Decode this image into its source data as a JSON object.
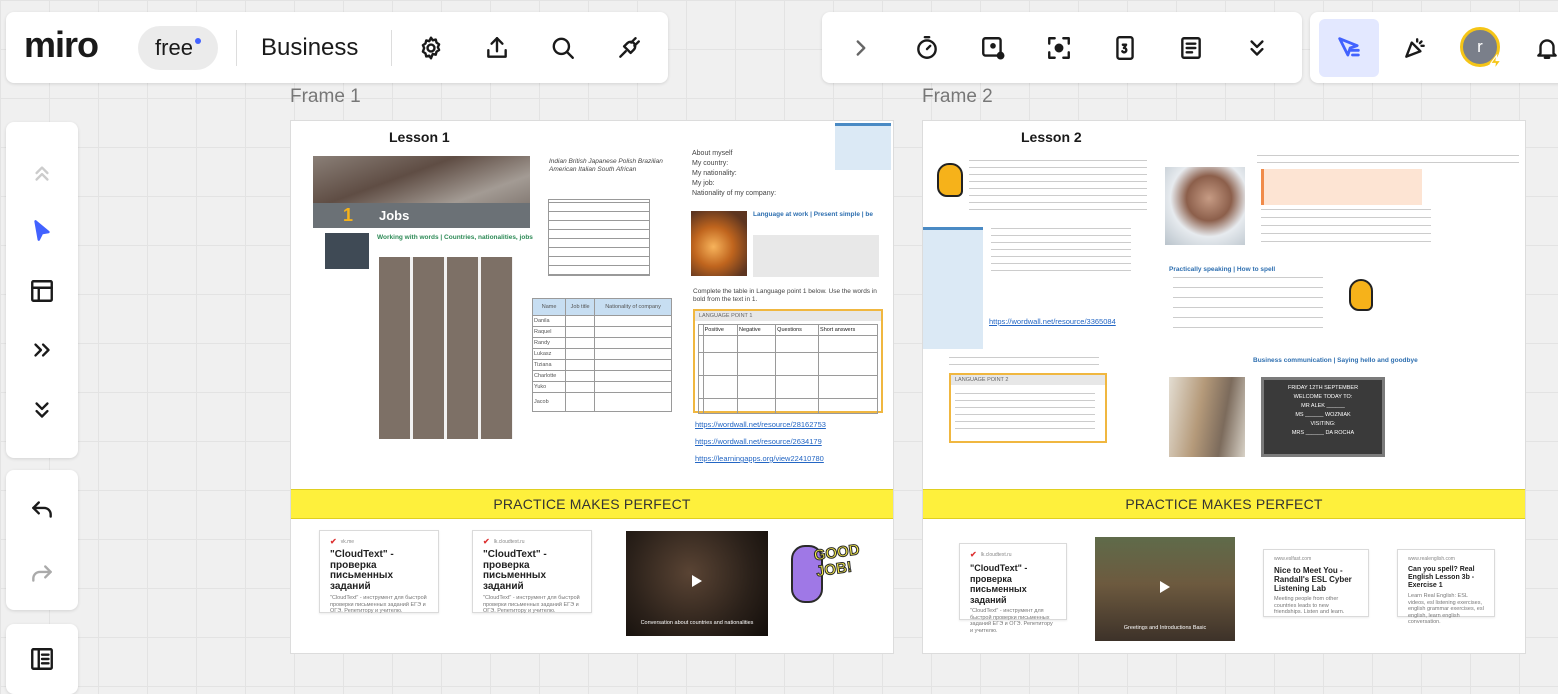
{
  "topbar": {
    "logo": "miro",
    "plan_badge": "free",
    "board_name": "Business",
    "accent": "#4262ff"
  },
  "toolbar_left_icons": [
    "settings-icon",
    "share-icon",
    "search-icon",
    "plugin-icon"
  ],
  "toolbar_center_icons": [
    "chevron-right-icon",
    "timer-icon",
    "frame-icon",
    "focus-icon",
    "card-count-icon",
    "notes-icon",
    "chevron-down-double-icon"
  ],
  "toolbar_right": {
    "avatar_letter": "r"
  },
  "sidebar_icons": [
    "chevron-up-double-icon",
    "select-cursor-icon",
    "templates-icon",
    "more-tools-icon",
    "collapse-icon"
  ],
  "frames": [
    {
      "label": "Frame 1",
      "lesson_title": "Lesson 1",
      "unit_number": "1",
      "unit_title": "Jobs",
      "about_myself": [
        "About myself",
        "My country:",
        "My nationality:",
        "My job:",
        "Nationality of my company:"
      ],
      "table_header": [
        "Name",
        "Job title",
        "Nationality of company"
      ],
      "table_names": [
        "Danila",
        "Raquel",
        "Randy",
        "Lukasz",
        "Tiziana",
        "Charlotte",
        "Yuko",
        "Jacob"
      ],
      "exercise_text": "Complete the table in Language point 1 below. Use the words in bold from the text in 1.",
      "language_point": "LANGUAGE POINT 1",
      "lp_header": [
        "",
        "Positive",
        "Negative",
        "Questions",
        "Short answers"
      ],
      "links": [
        "https://wordwall.net/resource/28162753",
        "https://wordwall.net/resource/2634179",
        "https://learningapps.org/view22410780"
      ],
      "band": "PRACTICE MAKES PERFECT",
      "cards": [
        {
          "src": "vk.me",
          "title": "\"CloudText\" - проверка письменных заданий",
          "desc": "\"CloudText\" - инструмент для быстрой проверки письменных заданий ЕГЭ и ОГЭ. Репетитору и учителю."
        },
        {
          "src": "lk.cloudtext.ru",
          "title": "\"CloudText\" - проверка письменных заданий",
          "desc": "\"CloudText\" - инструмент для быстрой проверки письменных заданий ЕГЭ и ОГЭ. Репетитору и учителю."
        }
      ],
      "video_caption": "Conversation about countries and nationalities",
      "sticker": "GOOD JOB!"
    },
    {
      "label": "Frame 2",
      "lesson_title": "Lesson 2",
      "link": "https://wordwall.net/resource/3365084",
      "practically_speaking": "Practically speaking | How to spell",
      "business_comm": "Business communication | Saying hello and goodbye",
      "language_point": "LANGUAGE POINT 2",
      "board_lines": [
        "FRIDAY 12TH SEPTEMBER",
        "WELCOME TODAY TO:",
        "MR ALEK ______",
        "MS ______ WOZNIAK",
        "VISITING:",
        "MRS ______ DA ROCHA"
      ],
      "band": "PRACTICE MAKES PERFECT",
      "cards": [
        {
          "src": "lk.cloudtext.ru",
          "title": "\"CloudText\" - проверка письменных заданий",
          "desc": "\"CloudText\" - инструмент для быстрой проверки письменных заданий ЕГЭ и ОГЭ. Репетитору и учителю."
        },
        {
          "src": "www.eslfast.com",
          "title": "Nice to Meet You - Randall's ESL Cyber Listening Lab",
          "desc": "Meeting people from other countries leads to new friendships. Listen and learn."
        },
        {
          "src": "www.realenglish.com",
          "title": "Can you spell? Real English Lesson 3b - Exercise 1",
          "desc": "Learn Real English: ESL videos, esl listening exercises, english grammar exercises, esl english, learn english conversation."
        }
      ],
      "video_caption": "Greetings and Introductions Basic"
    }
  ]
}
